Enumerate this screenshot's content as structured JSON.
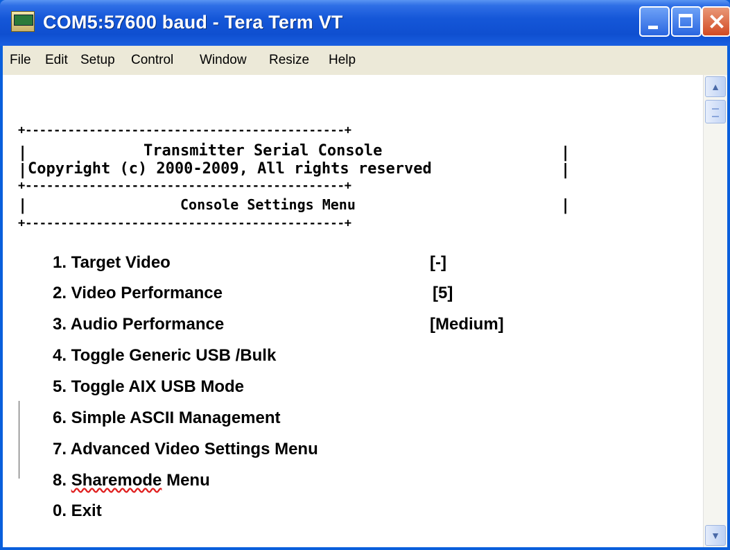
{
  "window": {
    "title": "COM5:57600 baud - Tera Term VT",
    "controls": [
      "minimize",
      "maximize",
      "close"
    ],
    "colors": {
      "titlebar": "#1557d8",
      "close": "#d24a23",
      "menubar": "#ece9d8"
    }
  },
  "menubar": {
    "items": [
      "File",
      "Edit",
      "Setup",
      "Control",
      "Window",
      "Resize",
      "Help"
    ]
  },
  "terminal": {
    "border_top": "+---------------------------------------------+",
    "border_mid": "+---------------------------------------------+",
    "border_bot": "+---------------------------------------------+",
    "side_bar": "|",
    "title": "Transmitter Serial Console",
    "copyright": "Copyright (c) 2000-2009, All rights reserved",
    "menu_title": "Console Settings Menu",
    "options": [
      {
        "label": "1. Target Video",
        "value": "[-]"
      },
      {
        "label": "2. Video Performance",
        "value": "[5]"
      },
      {
        "label": "3. Audio Performance",
        "value": "[Medium]"
      },
      {
        "label": "4. Toggle Generic USB /Bulk",
        "value": ""
      },
      {
        "label": "5. Toggle AIX USB Mode",
        "value": ""
      },
      {
        "label": "6. Simple ASCII Management",
        "value": ""
      },
      {
        "label": "7. Advanced Video Settings Menu",
        "value": ""
      },
      {
        "label_prefix": "8. ",
        "label_spell": "Sharemode",
        "label_suffix": " Menu",
        "value": ""
      },
      {
        "label": "0. Exit",
        "value": ""
      }
    ]
  },
  "icons": {
    "app": "tera-term-icon",
    "scroll_up": "scroll-up-arrow-icon",
    "scroll_down": "scroll-down-arrow-icon"
  }
}
